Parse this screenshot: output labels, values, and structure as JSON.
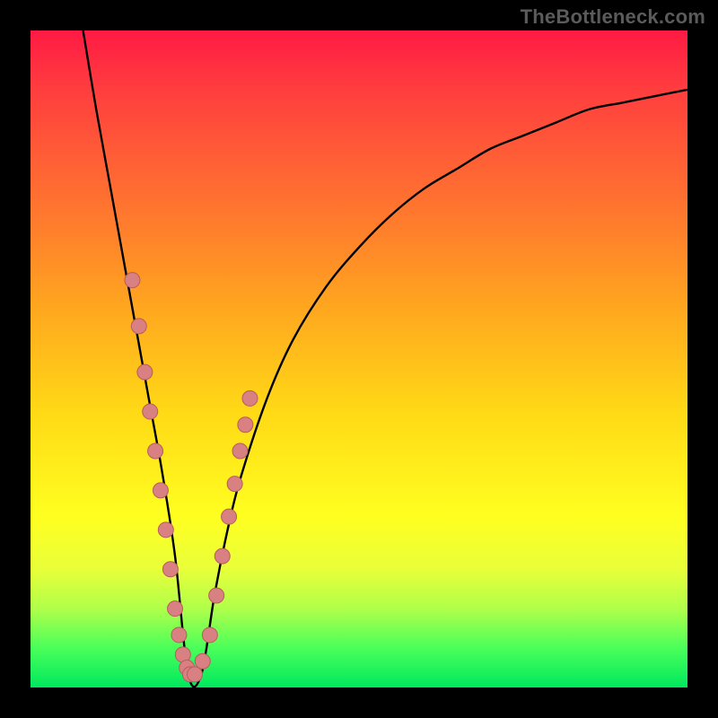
{
  "watermark": "TheBottleneck.com",
  "colors": {
    "page_bg": "#000000",
    "curve": "#000000",
    "marker_fill": "#d98082",
    "marker_stroke": "#b85c5e",
    "gradient_top": "#ff1a44",
    "gradient_bottom": "#00e85e"
  },
  "chart_data": {
    "type": "line",
    "title": "",
    "xlabel": "",
    "ylabel": "",
    "xlim": [
      0,
      100
    ],
    "ylim": [
      0,
      100
    ],
    "legend": false,
    "grid": false,
    "note": "Axes are unlabeled; values are estimated proportionally from the plot area. The curve is a V shape with minimum near x≈24, y≈0.",
    "series": [
      {
        "name": "curve",
        "x": [
          8,
          10,
          12,
          14,
          16,
          18,
          20,
          22,
          24,
          26,
          28,
          30,
          32,
          36,
          40,
          45,
          50,
          55,
          60,
          65,
          70,
          75,
          80,
          85,
          90,
          95,
          100
        ],
        "y": [
          100,
          88,
          77,
          66,
          55,
          44,
          33,
          20,
          2,
          2,
          14,
          24,
          32,
          44,
          53,
          61,
          67,
          72,
          76,
          79,
          82,
          84,
          86,
          88,
          89,
          90,
          91
        ]
      }
    ],
    "markers": {
      "name": "marker-dots",
      "x": [
        15.5,
        16.5,
        17.4,
        18.2,
        19.0,
        19.8,
        20.6,
        21.3,
        22.0,
        22.6,
        23.2,
        23.8,
        24.3,
        25.0,
        26.2,
        27.3,
        28.3,
        29.2,
        30.2,
        31.1,
        31.9,
        32.7,
        33.4
      ],
      "y": [
        62,
        55,
        48,
        42,
        36,
        30,
        24,
        18,
        12,
        8,
        5,
        3,
        2,
        2,
        4,
        8,
        14,
        20,
        26,
        31,
        36,
        40,
        44
      ]
    }
  }
}
